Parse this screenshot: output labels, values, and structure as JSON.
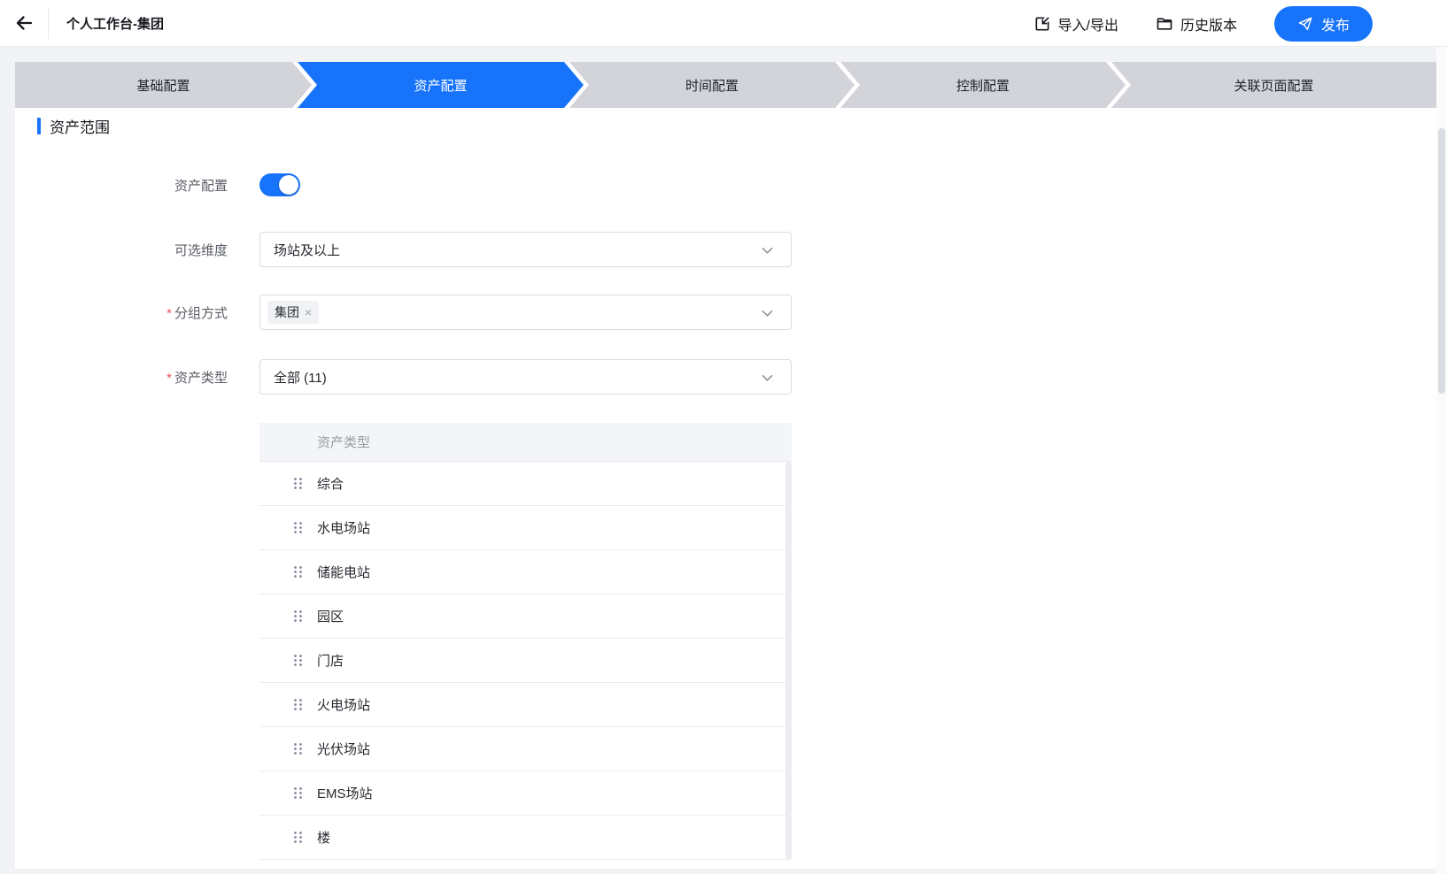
{
  "topbar": {
    "title": "个人工作台-集团",
    "import_export_label": "导入/导出",
    "history_label": "历史版本",
    "publish_label": "发布"
  },
  "steps": {
    "items": [
      {
        "label": "基础配置",
        "active": false
      },
      {
        "label": "资产配置",
        "active": true
      },
      {
        "label": "时间配置",
        "active": false
      },
      {
        "label": "控制配置",
        "active": false
      },
      {
        "label": "关联页面配置",
        "active": false
      }
    ]
  },
  "content": {
    "section_title": "资产范围",
    "fields": {
      "asset_config": {
        "label": "资产配置",
        "state": "on"
      },
      "dimension": {
        "label": "可选维度",
        "value": "场站及以上"
      },
      "grouping": {
        "label": "分组方式",
        "required_mark": "*",
        "tag": "集团",
        "tag_close": "×"
      },
      "asset_type": {
        "label": "资产类型",
        "required_mark": "*",
        "value": "全部 (11)"
      }
    }
  },
  "table": {
    "header": "资产类型",
    "rows": [
      "综合",
      "水电场站",
      "储能电站",
      "园区",
      "门店",
      "火电场站",
      "光伏场站",
      "EMS场站",
      "楼"
    ]
  },
  "colors": {
    "accent": "#1673fa",
    "step_inactive": "#d3d4da",
    "tag_background": "#f0f2f5"
  }
}
